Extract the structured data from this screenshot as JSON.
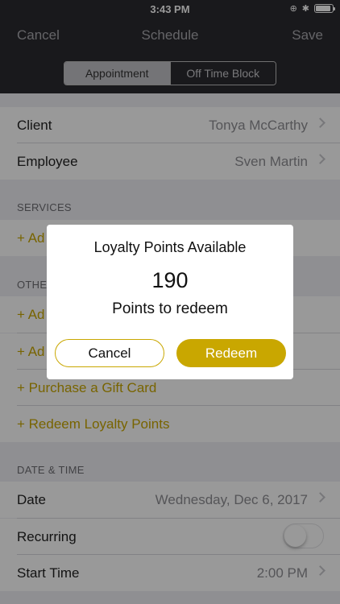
{
  "status_bar": {
    "time": "3:43 PM",
    "battery_level": 0.9
  },
  "nav": {
    "cancel": "Cancel",
    "title": "Schedule",
    "save": "Save"
  },
  "segments": {
    "appointment": "Appointment",
    "off_time": "Off Time Block"
  },
  "rows": {
    "client_label": "Client",
    "client_value": "Tonya McCarthy",
    "employee_label": "Employee",
    "employee_value": "Sven Martin"
  },
  "services": {
    "header": "SERVICES",
    "add": "+ Ad"
  },
  "other": {
    "header": "OTHE",
    "add1": "+ Ad",
    "add2": "+ Ad",
    "gift_card": "+ Purchase a Gift Card",
    "loyalty": "+ Redeem Loyalty Points"
  },
  "datetime": {
    "header": "DATE & TIME",
    "date_label": "Date",
    "date_value": "Wednesday, Dec 6, 2017",
    "recurring_label": "Recurring",
    "start_label": "Start Time",
    "start_value": "2:00 PM"
  },
  "dialog": {
    "title": "Loyalty Points Available",
    "points": "190",
    "subtitle": "Points to redeem",
    "cancel": "Cancel",
    "redeem": "Redeem"
  },
  "colors": {
    "accent": "#c9a700",
    "nav_bg": "#2b2a30"
  }
}
